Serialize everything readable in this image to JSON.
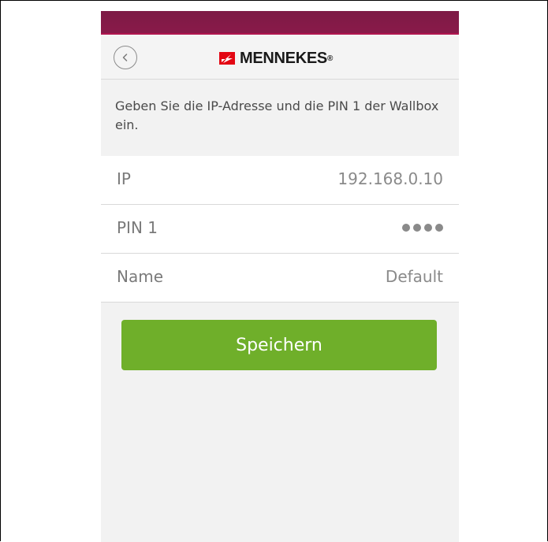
{
  "header": {
    "brand_name": "MENNEKES",
    "brand_reg": "®",
    "back_icon": "chevron-left-icon"
  },
  "instruction": "Geben Sie die IP-Adresse und die PIN 1 der Wallbox ein.",
  "form": {
    "ip": {
      "label": "IP",
      "value": "192.168.0.10"
    },
    "pin": {
      "label": "PIN 1",
      "masked_length": 4
    },
    "name": {
      "label": "Name",
      "value": "Default"
    }
  },
  "actions": {
    "save_label": "Speichern"
  },
  "colors": {
    "status_bar": "#7d1a45",
    "brand_red": "#e30613",
    "save_button": "#6faf2a",
    "background": "#f2f2f2"
  }
}
